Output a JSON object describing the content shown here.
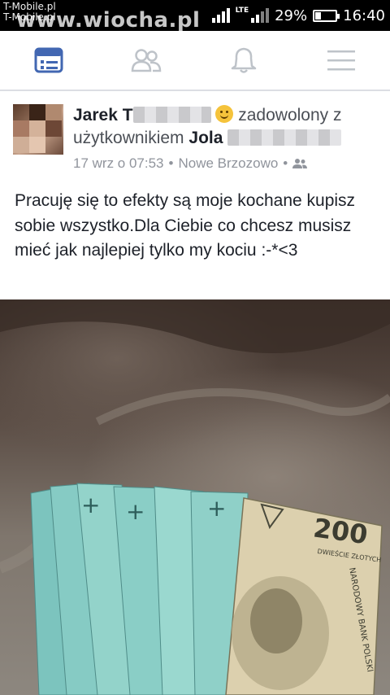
{
  "status_bar": {
    "carrier_line1": "T-Mobile.pl",
    "carrier_line2": "T-Mobile.pl",
    "watermark": "www.wiocha.pl",
    "network_type": "LTE",
    "battery_percent": "29%",
    "battery_level": 0.29,
    "time": "16:40"
  },
  "nav": {
    "tabs": [
      {
        "icon": "news-feed-icon",
        "active": true
      },
      {
        "icon": "friends-icon",
        "active": false
      },
      {
        "icon": "notifications-bell-icon",
        "active": false
      },
      {
        "icon": "menu-icon",
        "active": false
      }
    ],
    "active_color": "#4267b2",
    "inactive_color": "#bec3c9"
  },
  "post": {
    "author_first_name": "Jarek",
    "author_initial": "T",
    "feeling": "zadowolony",
    "feeling_suffix": "z",
    "with_phrase": "użytkownikiem",
    "tagged_first_name": "Jola",
    "date": "17 wrz o 07:53",
    "separator": "•",
    "location": "Nowe Brzozowo",
    "audience_icon": "friends-audience-icon",
    "text": "Pracuję się to efekty są moje kochane kupisz sobie wszystko.Dla Ciebie co chcesz musisz mieć jak najlepiej tylko my kociu :-*<3"
  },
  "photo": {
    "banknote_denomination": "200",
    "banknote_series_text": "DWIEŚCIE ZŁOTYCH",
    "banknote_country_text": "NARODOWY BANK POLSKI"
  }
}
